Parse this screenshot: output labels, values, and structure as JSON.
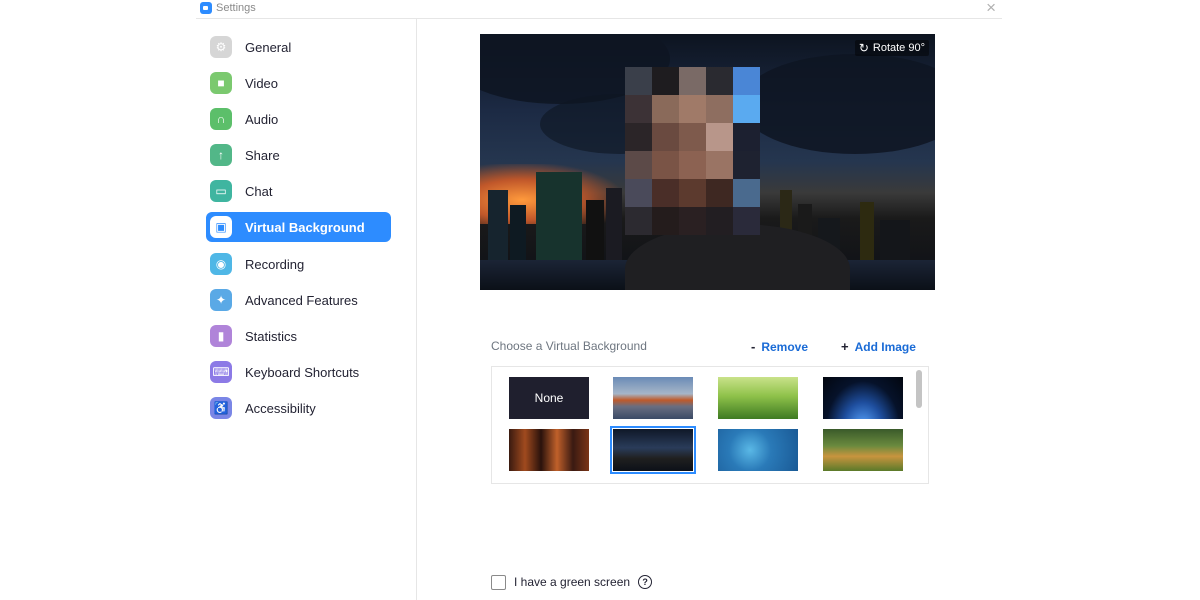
{
  "window": {
    "title": "Settings",
    "close_glyph": "×"
  },
  "sidebar": {
    "items": [
      {
        "label": "General",
        "icon": "gear-icon",
        "color": "#d6d6d6",
        "glyph": "⚙",
        "active": false
      },
      {
        "label": "Video",
        "icon": "video-camera-icon",
        "color": "#7bc96f",
        "glyph": "■",
        "active": false
      },
      {
        "label": "Audio",
        "icon": "headphones-icon",
        "color": "#5cbf6a",
        "glyph": "∩",
        "active": false
      },
      {
        "label": "Share",
        "icon": "share-screen-icon",
        "color": "#52b788",
        "glyph": "↑",
        "active": false
      },
      {
        "label": "Chat",
        "icon": "chat-bubble-icon",
        "color": "#3fb5a0",
        "glyph": "▭",
        "active": false
      },
      {
        "label": "Virtual Background",
        "icon": "virtual-background-icon",
        "color": "#2d8cff",
        "glyph": "▣",
        "active": true
      },
      {
        "label": "Recording",
        "icon": "recording-icon",
        "color": "#4fb7e6",
        "glyph": "◉",
        "active": false
      },
      {
        "label": "Advanced Features",
        "icon": "sparkle-icon",
        "color": "#5aa9e6",
        "glyph": "✦",
        "active": false
      },
      {
        "label": "Statistics",
        "icon": "bar-chart-icon",
        "color": "#b084d9",
        "glyph": "▮",
        "active": false
      },
      {
        "label": "Keyboard Shortcuts",
        "icon": "keyboard-icon",
        "color": "#8c7ae6",
        "glyph": "⌨",
        "active": false
      },
      {
        "label": "Accessibility",
        "icon": "accessibility-icon",
        "color": "#7a86e6",
        "glyph": "♿",
        "active": false
      }
    ]
  },
  "preview": {
    "rotate_label": "Rotate 90°"
  },
  "backgrounds": {
    "heading": "Choose a Virtual Background",
    "remove_label": "Remove",
    "add_label": "Add Image",
    "none_label": "None",
    "thumbnails": [
      {
        "name": "none",
        "label": "None"
      },
      {
        "name": "golden-gate-bridge",
        "label": ""
      },
      {
        "name": "grass",
        "label": ""
      },
      {
        "name": "earth-from-space",
        "label": ""
      },
      {
        "name": "night-street",
        "label": ""
      },
      {
        "name": "city-skyline-night",
        "label": "",
        "selected": true
      },
      {
        "name": "world-map-network",
        "label": ""
      },
      {
        "name": "dog-in-park",
        "label": ""
      }
    ]
  },
  "green_screen": {
    "label": "I have a green screen",
    "checked": false,
    "help_glyph": "?"
  }
}
